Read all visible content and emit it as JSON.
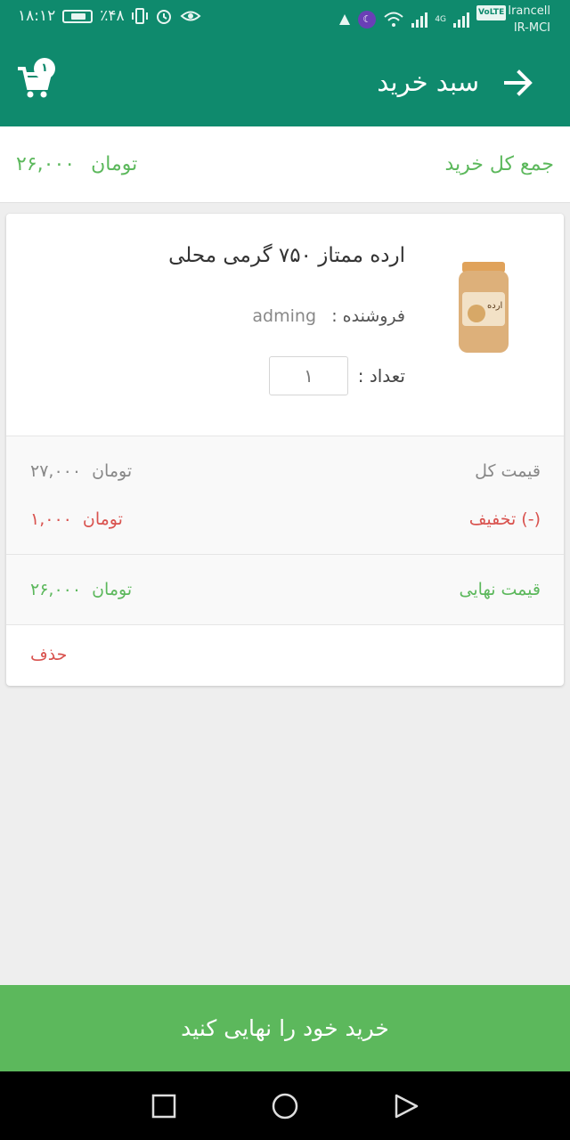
{
  "status_bar": {
    "time": "۱۸:۱۲",
    "battery_percent": "٪۴۸",
    "carrier_line1": "Irancell",
    "carrier_line2": "IR-MCI",
    "volte": "VoLTE",
    "network": "4G"
  },
  "app_bar": {
    "title": "سبد خرید",
    "cart_count": "۱"
  },
  "summary": {
    "total_label": "جمع کل خرید",
    "total_amount": "۲۶,۰۰۰",
    "currency": "تومان"
  },
  "cart_item": {
    "name": "ارده ممتاز ۷۵۰ گرمی محلی",
    "seller_label": "فروشنده :",
    "seller": "adming",
    "quantity_label": "تعداد :",
    "quantity": "۱",
    "image_text": "ارده",
    "total_price_label": "قیمت کل",
    "total_price": "۲۷,۰۰۰",
    "discount_label": "(-) تخفیف",
    "discount": "۱,۰۰۰",
    "final_price_label": "قیمت نهایی",
    "final_price": "۲۶,۰۰۰",
    "currency": "تومان",
    "delete_label": "حذف"
  },
  "checkout": {
    "label": "خرید خود را نهایی کنید"
  },
  "colors": {
    "primary": "#0f8a6d",
    "accent_green": "#5cb85c",
    "danger": "#d9534f"
  }
}
